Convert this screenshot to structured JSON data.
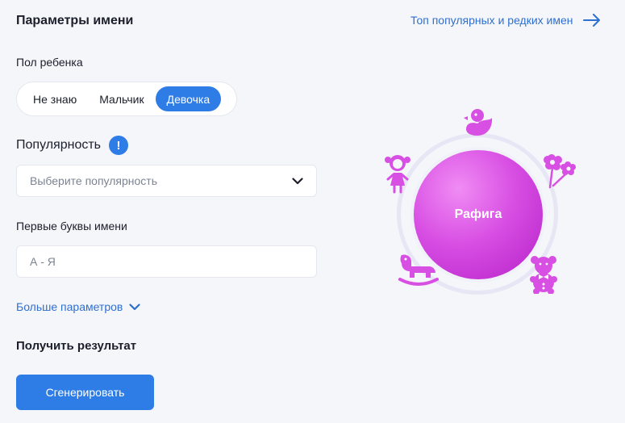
{
  "header": {
    "title": "Параметры имени",
    "top_link": "Топ популярных и редких имен"
  },
  "gender": {
    "label": "Пол ребенка",
    "options": [
      "Не знаю",
      "Мальчик",
      "Девочка"
    ],
    "selected": "Девочка"
  },
  "popularity": {
    "label": "Популярность",
    "info_icon": "!",
    "select_value": "Выберите популярность"
  },
  "first_letters": {
    "label": "Первые буквы имени",
    "placeholder": "А - Я"
  },
  "more_params": "Больше параметров",
  "result": {
    "title": "Получить результат",
    "generate_button": "Сгенерировать",
    "name": "Рафига"
  },
  "icons": {
    "accent": "#2e7ce6",
    "toy_color": "#d84fe3",
    "toys": [
      "duck-icon",
      "girl-icon",
      "flowers-icon",
      "rocking-horse-icon",
      "teddy-bear-icon"
    ]
  }
}
